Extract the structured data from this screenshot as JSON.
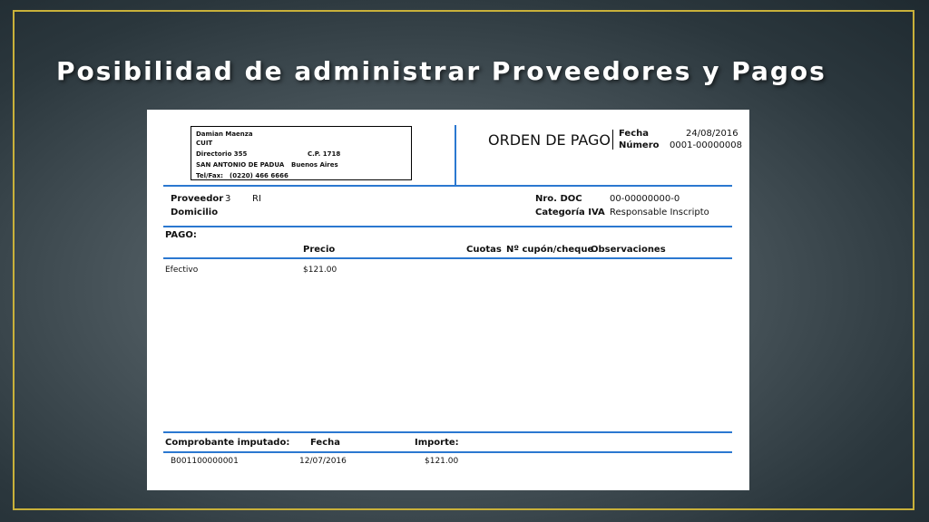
{
  "slide": {
    "title": "Posibilidad de administrar Proveedores y Pagos"
  },
  "document": {
    "company": {
      "name": "Damian Maenza",
      "cuit_label": "CUIT",
      "address": "Directorio 355",
      "postal_code": "C.P. 1718",
      "city": "SAN ANTONIO DE PADUA",
      "province": "Buenos Aires",
      "phone_label": "Tel/Fax:",
      "phone": "(0220) 466 6666"
    },
    "header": {
      "doc_title": "ORDEN DE PAGO",
      "date_label": "Fecha",
      "date_value": "24/08/2016",
      "number_label": "Número",
      "number_value": "0001-00000008"
    },
    "supplier": {
      "proveedor_label": "Proveedor",
      "proveedor_code": "3",
      "proveedor_name": "RI",
      "domicilio_label": "Domicilio",
      "nro_doc_label": "Nro. DOC",
      "nro_doc_value": "00-00000000-0",
      "categoria_label": "Categoría IVA",
      "categoria_value": "Responsable Inscripto"
    },
    "payment": {
      "section_label": "PAGO:",
      "columns": {
        "precio": "Precio",
        "cuotas": "Cuotas",
        "cupon": "Nº cupón/cheque",
        "observaciones": "Observaciones"
      },
      "rows": [
        {
          "method": "Efectivo",
          "precio": "$121.00"
        }
      ]
    },
    "imputed": {
      "columns": {
        "comprobante": "Comprobante imputado:",
        "fecha": "Fecha",
        "importe": "Importe:"
      },
      "rows": [
        {
          "comprobante": "B001100000001",
          "fecha": "12/07/2016",
          "importe": "$121.00"
        }
      ]
    }
  }
}
